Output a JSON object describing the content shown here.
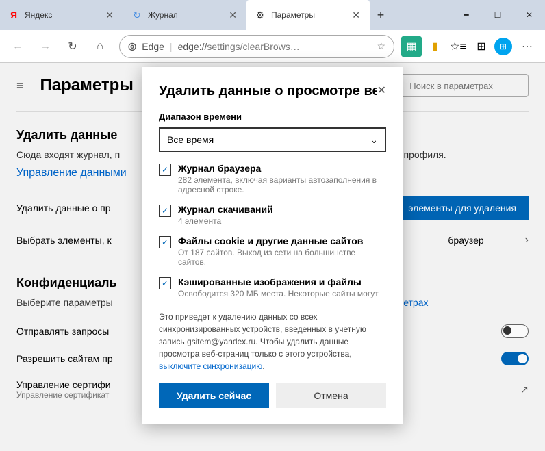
{
  "titlebar": {
    "tabs": [
      {
        "label": "Яндекс",
        "icon_color": "#ff0000",
        "icon": "Я"
      },
      {
        "label": "Журнал",
        "icon": "↻"
      },
      {
        "label": "Параметры",
        "icon": "⚙"
      }
    ]
  },
  "toolbar": {
    "edge_label": "Edge",
    "url_prefix": "edge://",
    "url_rest": "settings/clearBrows…"
  },
  "settings": {
    "page_title": "Параметры",
    "search_placeholder": "Поиск в параметрах",
    "section1_title": "Удалить данные",
    "section1_desc_start": "Сюда входят журнал, п",
    "section1_desc_end": "данные этого профиля.",
    "data_management_link": "Управление данными",
    "row1_label": "Удалить данные о пр",
    "row1_button": "элементы для удаления",
    "row2_label": "Выбрать элементы, к",
    "row2_right": "браузер",
    "section2_title": "Конфиденциаль",
    "section2_desc_start": "Выберите параметры",
    "section2_link_end": "параметрах",
    "row3_label": "Отправлять запросы",
    "row4_label": "Разрешить сайтам пр",
    "row5_label": "Управление сертифи",
    "row5_sub": "Управление сертификат"
  },
  "modal": {
    "title": "Удалить данные о просмотре веб-стран",
    "range_label": "Диапазон времени",
    "range_value": "Все время",
    "items": [
      {
        "label": "Журнал браузера",
        "sub": "282 элемента, включая варианты автозаполнения в адресной строке.",
        "checked": true
      },
      {
        "label": "Журнал скачиваний",
        "sub": "4 элемента",
        "checked": true
      },
      {
        "label": "Файлы cookie и другие данные сайтов",
        "sub": "От 187 сайтов. Выход из сети на большинстве сайтов.",
        "checked": true
      },
      {
        "label": "Кэшированные изображения и файлы",
        "sub": "Освободится 320 МБ места. Некоторые сайты могут",
        "checked": true
      }
    ],
    "footer_text_1": "Это приведет к удалению данных со всех синхронизированных устройств, введенных в учетную запись gsitem@yandex.ru. Чтобы удалить данные просмотра веб-страниц только с этого устройства, ",
    "footer_link": "выключите синхронизацию",
    "footer_text_2": ".",
    "btn_confirm": "Удалить сейчас",
    "btn_cancel": "Отмена"
  }
}
